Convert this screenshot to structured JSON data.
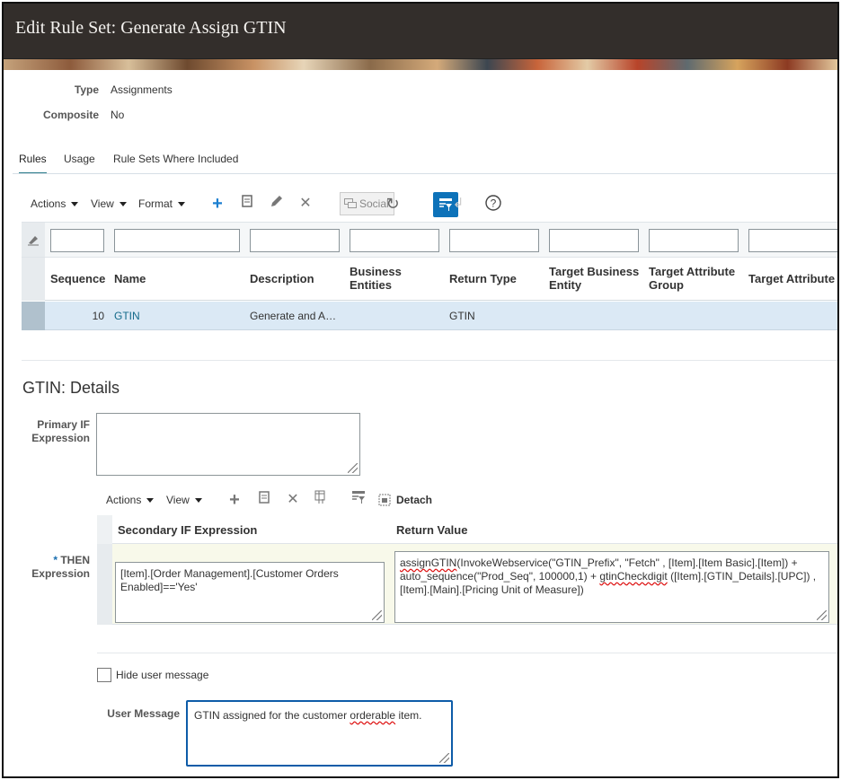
{
  "header": {
    "title": "Edit Rule Set: Generate Assign GTIN"
  },
  "info": {
    "type_label": "Type",
    "type_value": "Assignments",
    "composite_label": "Composite",
    "composite_value": "No"
  },
  "tabs": [
    {
      "label": "Rules",
      "active": true
    },
    {
      "label": "Usage",
      "active": false
    },
    {
      "label": "Rule Sets Where Included",
      "active": false
    }
  ],
  "toolbar": {
    "actions": "Actions",
    "view": "View",
    "format": "Format",
    "social": "Social",
    "icons": [
      "add-icon",
      "detach-icon",
      "edit-icon",
      "delete-icon",
      "social-icon",
      "refresh-icon",
      "query-by-example-icon",
      "return-icon",
      "help-icon"
    ]
  },
  "table": {
    "columns": [
      "Sequence",
      "Name",
      "Description",
      "Business Entities",
      "Return Type",
      "Target Business Entity",
      "Target Attribute Group",
      "Target Attribute"
    ],
    "rows": [
      {
        "sequence": "10",
        "name": "GTIN",
        "description": "Generate and A…",
        "business_entities": "",
        "return_type": "GTIN",
        "target_business_entity": "",
        "target_attribute_group": "",
        "target_attribute": ""
      }
    ]
  },
  "details": {
    "title": "GTIN: Details",
    "primary_if_label": "Primary IF Expression",
    "primary_if_value": "",
    "sub_toolbar": {
      "actions": "Actions",
      "view": "View",
      "detach": "Detach"
    },
    "sub_columns": [
      "Secondary IF Expression",
      "Return Value"
    ],
    "required_marker": "*",
    "then_label": "THEN Expression",
    "secondary_if_value": "[Item].[Order Management].[Customer Orders Enabled]=='Yes'",
    "return_value": {
      "p1_fn": "assignGTIN",
      "p1_rest": "(InvokeWebservice(\"GTIN_Prefix\", \"Fetch\" ,  [Item].[Item Basic].[Item]) +",
      "p2": "auto_sequence(\"Prod_Seq\", 100000,1) +",
      "p2_fn": "gtinCheckdigit",
      "p2_rest": " ([Item].[GTIN_Details].[UPC]) ,",
      "p3": "[Item].[Main].[Pricing Unit of Measure])"
    },
    "hide_message_label": "Hide user message",
    "hide_message_checked": false,
    "user_message_label": "User Message",
    "user_message_pre": "GTIN assigned for the customer ",
    "user_message_word": "orderable",
    "user_message_post": " item."
  },
  "colors": {
    "header_bg": "#332e2b",
    "accent": "#0d72b9",
    "link": "#136a8a",
    "selected_row": "#dbe9f5"
  }
}
